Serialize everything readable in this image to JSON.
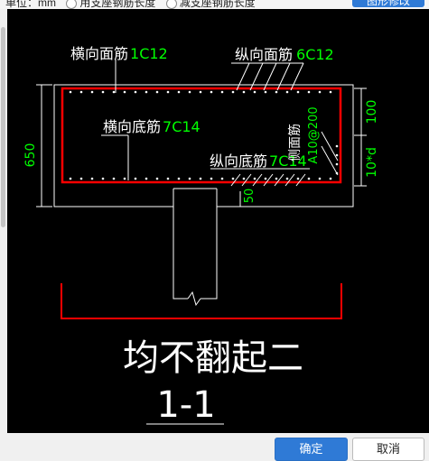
{
  "top_bar": {
    "unit_label": "单位：mm",
    "option_1": "用支座钢筋长度",
    "option_2": "减支座钢筋长度",
    "top_button": "图形修改"
  },
  "drawing": {
    "top_transverse_label": "横向面筋",
    "top_transverse_spec": "1C12",
    "top_longitudinal_label": "纵向面筋",
    "top_longitudinal_spec": "6C12",
    "bottom_transverse_label": "横向底筋",
    "bottom_transverse_spec": "7C14",
    "bottom_longitudinal_label": "纵向底筋",
    "bottom_longitudinal_spec": "7C14",
    "side_label": "侧面筋",
    "side_spec": "A10@200",
    "dim_height": "650",
    "dim_top": "100",
    "dim_side": "10*d",
    "dim_bottom": "50",
    "main_title": "均不翻起二",
    "section_label": "1-1",
    "colors": {
      "background": "#000000",
      "rebar": "#ff0000",
      "text": "#ffffff",
      "spec": "#00ff00"
    }
  },
  "footer": {
    "confirm_label": "确定",
    "cancel_label": "取消"
  }
}
